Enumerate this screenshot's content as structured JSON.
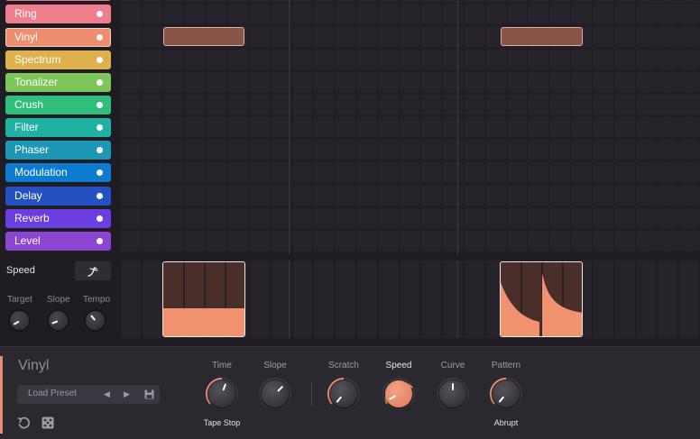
{
  "lanes": [
    {
      "label": "Ring",
      "color": "#ee7e8c"
    },
    {
      "label": "Vinyl",
      "color": "#ef8e6f",
      "active": true
    },
    {
      "label": "Spectrum",
      "color": "#deb14d"
    },
    {
      "label": "Tonalizer",
      "color": "#7dc75a"
    },
    {
      "label": "Crush",
      "color": "#2fbf7a"
    },
    {
      "label": "Filter",
      "color": "#1fb2a2"
    },
    {
      "label": "Phaser",
      "color": "#1d97b5"
    },
    {
      "label": "Modulation",
      "color": "#0d7bd0"
    },
    {
      "label": "Delay",
      "color": "#2451c2"
    },
    {
      "label": "Reverb",
      "color": "#6a3ee0"
    },
    {
      "label": "Level",
      "color": "#8a45d2"
    }
  ],
  "speed": {
    "label": "Speed",
    "curve_icon": "speed-curve-icon",
    "knobs": [
      "Target",
      "Slope",
      "Tempo"
    ]
  },
  "panel": {
    "title": "Vinyl",
    "preset": "Load Preset",
    "knobs": [
      {
        "label": "Time",
        "sub": "Tape Stop",
        "lit": false
      },
      {
        "label": "Slope",
        "sub": "",
        "lit": false
      },
      {
        "label": "Scratch",
        "sub": "",
        "lit": false
      },
      {
        "label": "Speed",
        "sub": "",
        "lit": true
      },
      {
        "label": "Curve",
        "sub": "",
        "lit": false
      },
      {
        "label": "Pattern",
        "sub": "Abrupt",
        "lit": false
      }
    ],
    "accent": "#e98c6e"
  }
}
